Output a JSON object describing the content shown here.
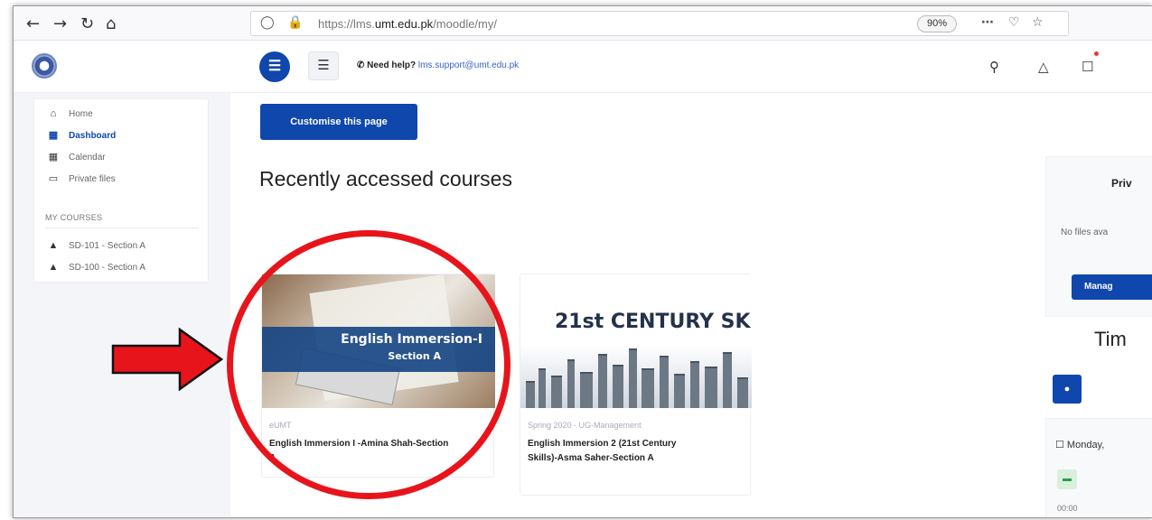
{
  "browser": {
    "nav_icons": [
      "back-icon",
      "forward-icon",
      "reload-icon",
      "home-icon"
    ],
    "url_prefix": "https://lms.",
    "url_domain": "umt.edu.pk",
    "url_path": "/moodle/my/",
    "zoom": "90%",
    "url_icons": [
      "shield-icon",
      "lock-icon",
      "more-icon",
      "pocket-icon",
      "star-icon"
    ]
  },
  "header": {
    "help_label": "Need help?",
    "help_email": "lms.support@umt.edu.pk",
    "icons": [
      "search-icon",
      "bell-icon",
      "chat-icon"
    ]
  },
  "sidebar": {
    "items": [
      {
        "label": "Home",
        "icon": "home-icon",
        "active": false
      },
      {
        "label": "Dashboard",
        "icon": "dashboard-icon",
        "active": true
      },
      {
        "label": "Calendar",
        "icon": "calendar-icon",
        "active": false
      },
      {
        "label": "Private files",
        "icon": "folder-icon",
        "active": false
      }
    ],
    "section_title": "MY COURSES",
    "courses": [
      {
        "label": "SD-101 - Section A",
        "icon": "graduation-cap-icon"
      },
      {
        "label": "SD-100 - Section A",
        "icon": "graduation-cap-icon"
      }
    ]
  },
  "main": {
    "customise_label": "Customise this page",
    "heading": "Recently accessed courses",
    "courses": [
      {
        "image_title": "English Immersion-I",
        "image_subtitle": "Section A",
        "category": "eUMT",
        "title": "English Immersion I -Amina Shah-Section A"
      },
      {
        "image_title": "21st CENTURY SK",
        "category": "Spring 2020 - UG-Management",
        "title": "English Immersion 2 (21st Century Skills)-Asma Saher-Section A"
      }
    ]
  },
  "right_panel": {
    "private_title": "Priv",
    "no_files": "No files ava",
    "manage_label": "Manag",
    "timeline_title": "Tim",
    "date_label": "Monday,",
    "event_time": "00:00"
  },
  "annotation": {
    "highlight_color": "#e8141b"
  }
}
